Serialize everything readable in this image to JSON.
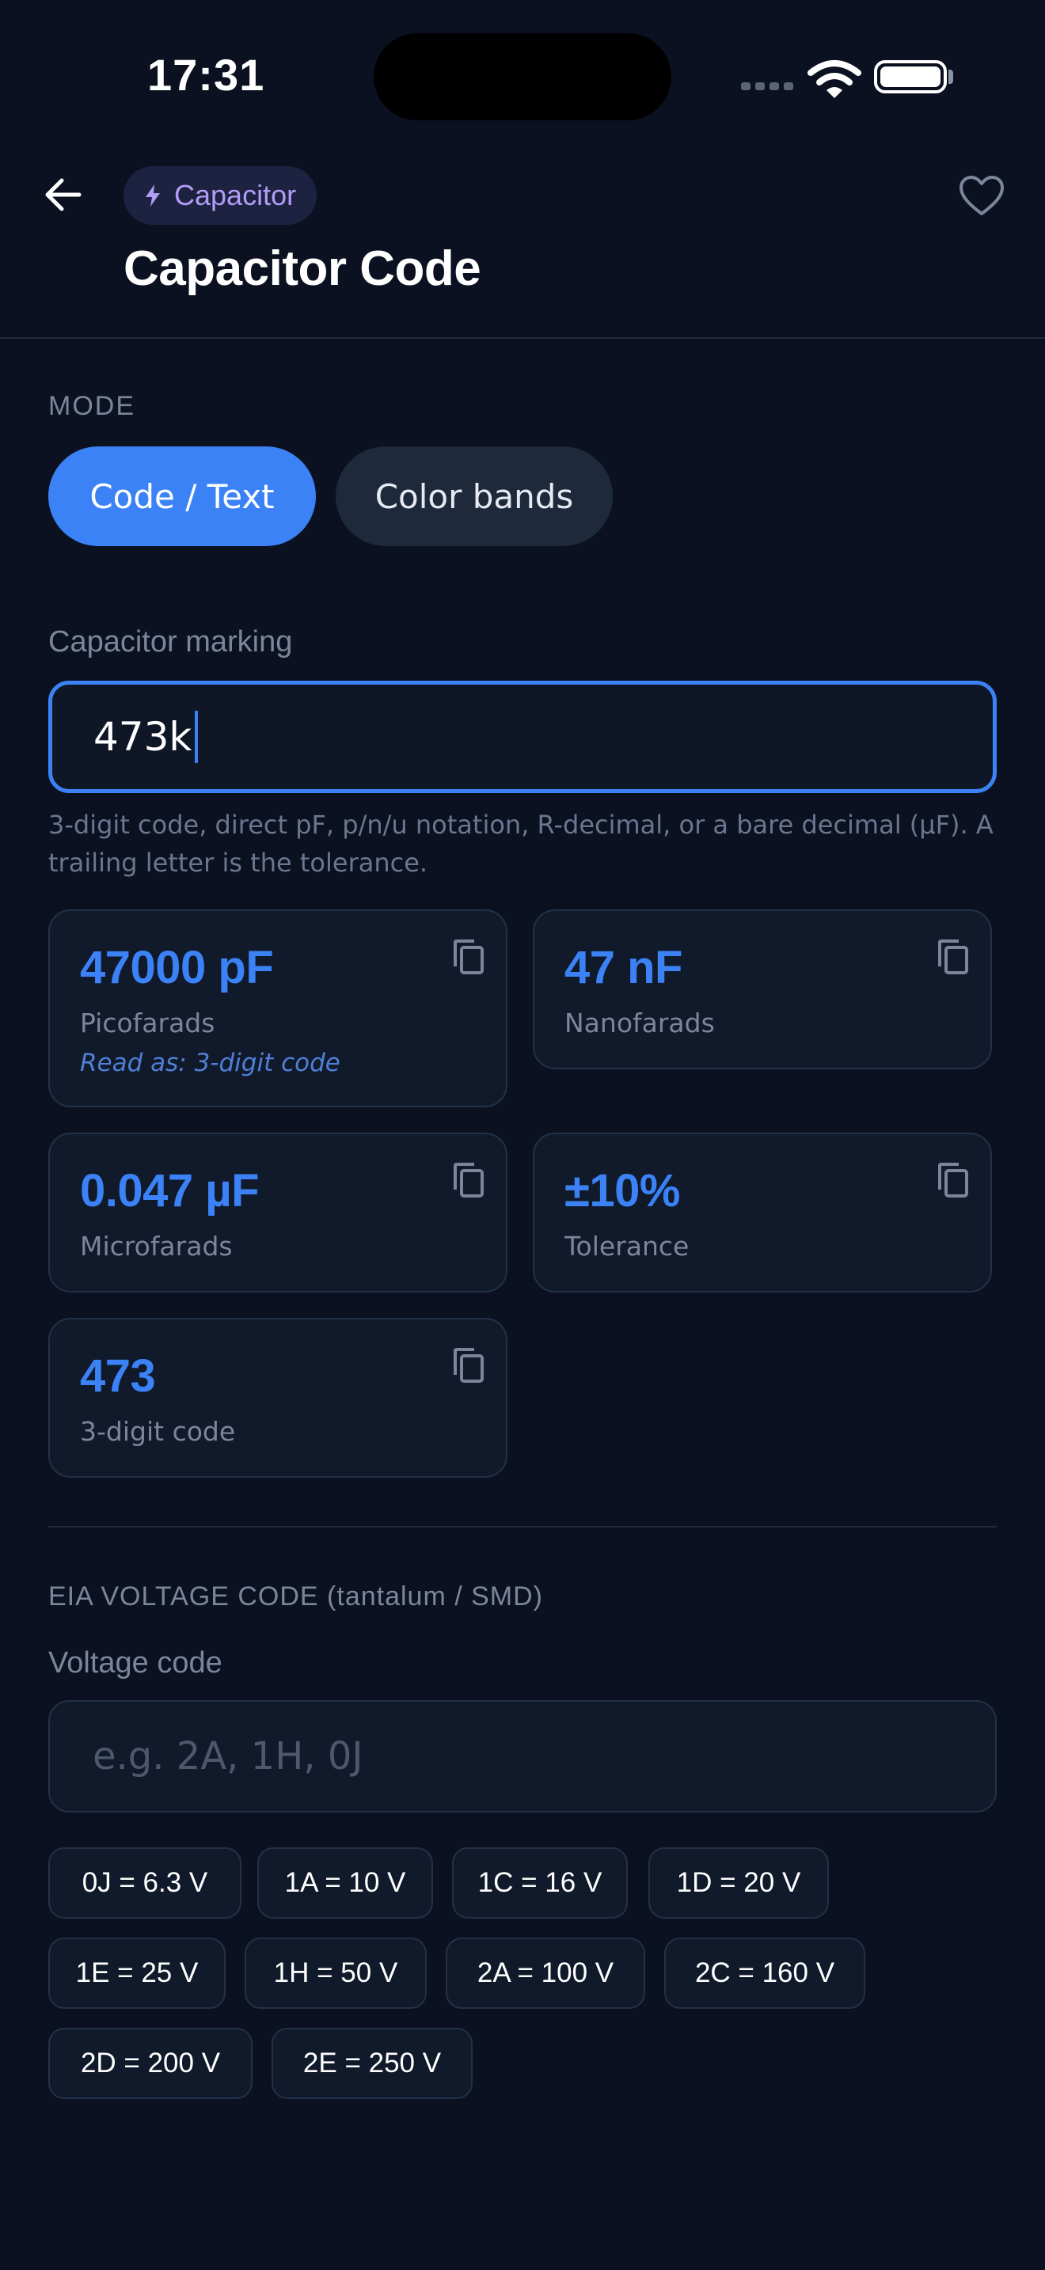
{
  "status_bar": {
    "time": "17:31"
  },
  "header": {
    "category": "Capacitor",
    "title": "Capacitor Code",
    "icons": {
      "back": "arrow-left-icon",
      "favorite": "heart-outline-icon",
      "category": "lightning-bolt-icon"
    }
  },
  "mode": {
    "label": "MODE",
    "options": [
      "Code / Text",
      "Color bands"
    ],
    "selected": "Code / Text"
  },
  "marking": {
    "label": "Capacitor marking",
    "value": "473k",
    "helper": "3-digit code, direct pF, p/n/u notation, R-decimal, or a bare decimal (µF). A trailing letter is the tolerance."
  },
  "results": [
    {
      "value": "47000 pF",
      "unit": "Picofarads",
      "note": "Read as: 3-digit code"
    },
    {
      "value": "47 nF",
      "unit": "Nanofarads"
    },
    {
      "value": "0.047 µF",
      "unit": "Microfarads"
    },
    {
      "value": "±10%",
      "unit": "Tolerance"
    },
    {
      "value": "473",
      "unit": "3-digit code"
    }
  ],
  "voltage": {
    "section_title": "EIA VOLTAGE CODE (tantalum / SMD)",
    "label": "Voltage code",
    "value": "",
    "placeholder": "e.g. 2A, 1H, 0J",
    "codes": [
      "0J = 6.3 V",
      "1A = 10 V",
      "1C = 16 V",
      "1D = 20 V",
      "1E = 25 V",
      "1H = 50 V",
      "2A = 100 V",
      "2C = 160 V",
      "2D = 200 V",
      "2E = 250 V"
    ]
  },
  "colors": {
    "accent": "#3b82f6",
    "background": "#0b1120",
    "category_tint": "#b19cf6"
  }
}
